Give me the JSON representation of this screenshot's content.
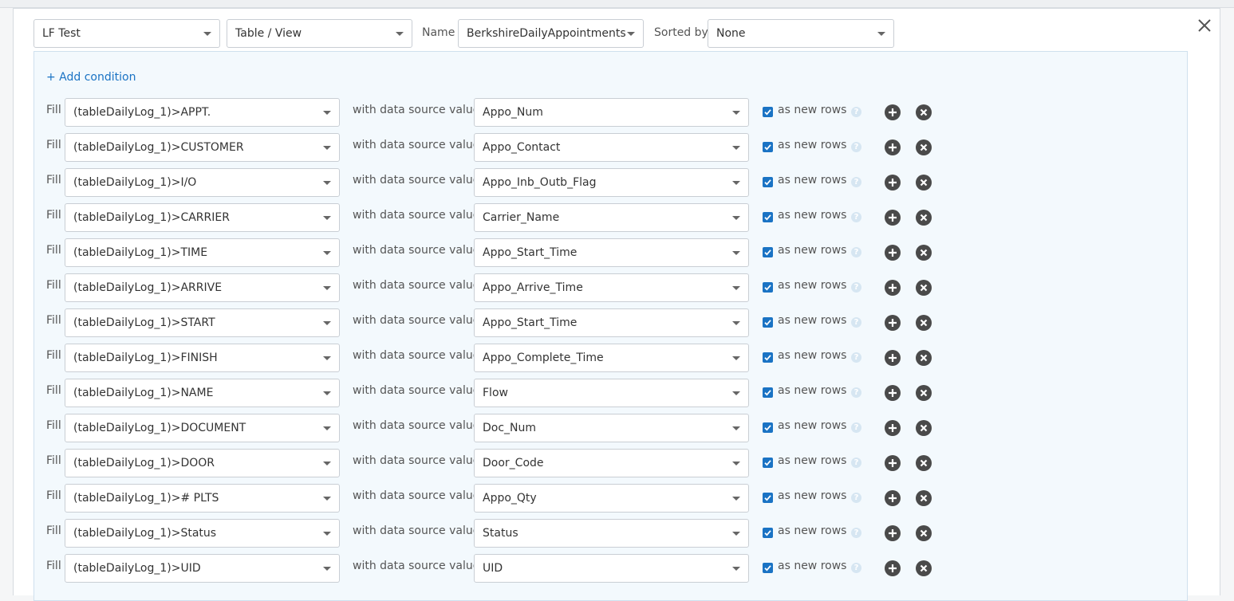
{
  "header": {
    "connection": "LF Test",
    "object_type": "Table / View",
    "name_label": "Name",
    "name_value": "BerkshireDailyAppointments",
    "sorted_label": "Sorted by",
    "sorted_value": "None"
  },
  "add_condition_label": "+ Add condition",
  "row_labels": {
    "fill": "Fill",
    "with": "with data source value",
    "as_new_rows": "as new rows",
    "help": "?"
  },
  "mappings": [
    {
      "target": "(tableDailyLog_1)>APPT.",
      "source": "Appo_Num",
      "as_new_rows": true
    },
    {
      "target": "(tableDailyLog_1)>CUSTOMER",
      "source": "Appo_Contact",
      "as_new_rows": true
    },
    {
      "target": "(tableDailyLog_1)>I/O",
      "source": "Appo_Inb_Outb_Flag",
      "as_new_rows": true
    },
    {
      "target": "(tableDailyLog_1)>CARRIER",
      "source": "Carrier_Name",
      "as_new_rows": true
    },
    {
      "target": "(tableDailyLog_1)>TIME",
      "source": "Appo_Start_Time",
      "as_new_rows": true
    },
    {
      "target": "(tableDailyLog_1)>ARRIVE",
      "source": "Appo_Arrive_Time",
      "as_new_rows": true
    },
    {
      "target": "(tableDailyLog_1)>START",
      "source": "Appo_Start_Time",
      "as_new_rows": true
    },
    {
      "target": "(tableDailyLog_1)>FINISH",
      "source": "Appo_Complete_Time",
      "as_new_rows": true
    },
    {
      "target": "(tableDailyLog_1)>NAME",
      "source": "Flow",
      "as_new_rows": true
    },
    {
      "target": "(tableDailyLog_1)>DOCUMENT",
      "source": "Doc_Num",
      "as_new_rows": true
    },
    {
      "target": "(tableDailyLog_1)>DOOR",
      "source": "Door_Code",
      "as_new_rows": true
    },
    {
      "target": "(tableDailyLog_1)># PLTS",
      "source": "Appo_Qty",
      "as_new_rows": true
    },
    {
      "target": "(tableDailyLog_1)>Status",
      "source": "Status",
      "as_new_rows": true
    },
    {
      "target": "(tableDailyLog_1)>UID",
      "source": "UID",
      "as_new_rows": true
    }
  ],
  "icons": {
    "close": "close-icon",
    "caret": "chevron-down-icon",
    "add": "plus-circle-icon",
    "remove": "x-circle-icon",
    "check": "check-icon",
    "help": "question-circle-icon"
  },
  "colors": {
    "accent": "#1a73c4",
    "rules_background": "#f3f9fd",
    "icon_button": "#4a4a4a"
  }
}
